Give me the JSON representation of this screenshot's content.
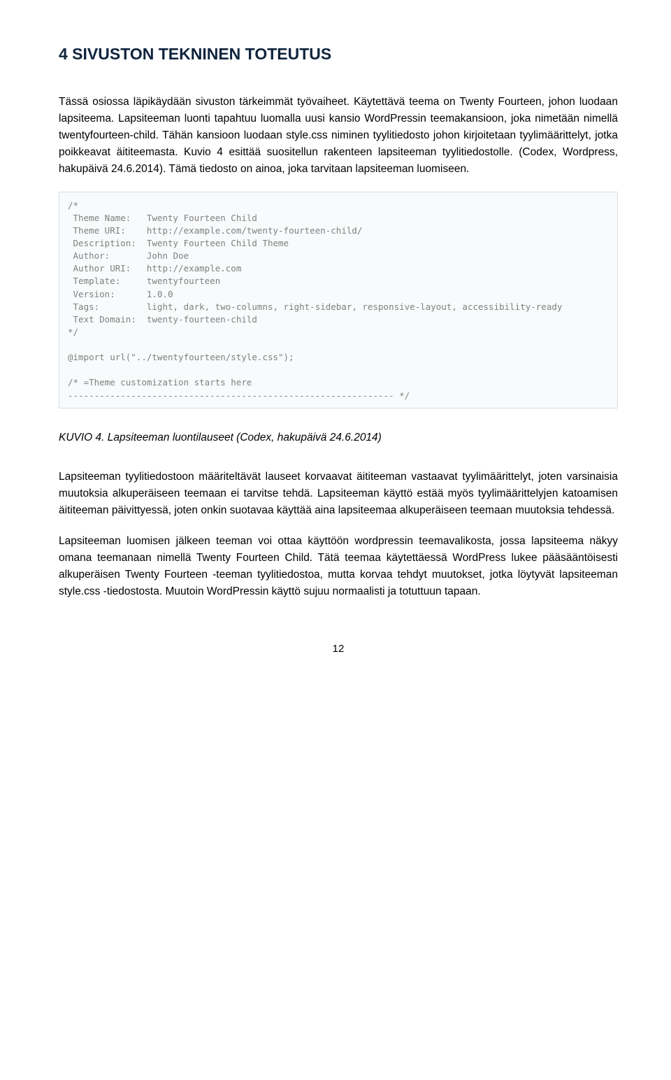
{
  "heading": "4   SIVUSTON TEKNINEN TOTEUTUS",
  "para1": "Tässä osiossa läpikäydään sivuston tärkeimmät työvaiheet. Käytettävä teema on Twenty Fourteen, johon luodaan lapsiteema. Lapsiteeman luonti tapahtuu luomalla uusi kansio WordPressin teemakansioon, joka nimetään nimellä twentyfourteen-child. Tähän kansioon luodaan style.css niminen tyylitiedosto johon kirjoitetaan tyylimäärittelyt, jotka poikkeavat äititeemasta. Kuvio 4 esittää suositellun rakenteen lapsiteeman tyylitiedostolle. (Codex, Wordpress, hakupäivä 24.6.2014). Tämä tiedosto on ainoa, joka tarvitaan lapsiteeman luomiseen.",
  "code": {
    "l01": "/*",
    "l02": " Theme Name:   Twenty Fourteen Child",
    "l03": " Theme URI:    http://example.com/twenty-fourteen-child/",
    "l04": " Description:  Twenty Fourteen Child Theme",
    "l05": " Author:       John Doe",
    "l06": " Author URI:   http://example.com",
    "l07": " Template:     twentyfourteen",
    "l08": " Version:      1.0.0",
    "l09": " Tags:         light, dark, two-columns, right-sidebar, responsive-layout, accessibility-ready",
    "l10": " Text Domain:  twenty-fourteen-child",
    "l11": "*/",
    "l12": "",
    "l13": "@import url(\"../twentyfourteen/style.css\");",
    "l14": "",
    "l15": "/* =Theme customization starts here",
    "l16": "-------------------------------------------------------------- */"
  },
  "caption": "KUVIO 4. Lapsiteeman luontilauseet (Codex, hakupäivä 24.6.2014)",
  "para2": "Lapsiteeman tyylitiedostoon määriteltävät lauseet korvaavat äititeeman vastaavat tyylimäärittelyt, joten varsinaisia muutoksia alkuperäiseen teemaan ei tarvitse tehdä. Lapsiteeman käyttö estää myös tyylimäärittelyjen katoamisen äititeeman päivittyessä, joten onkin suotavaa käyttää aina lapsiteemaa alkuperäiseen teemaan muutoksia tehdessä.",
  "para3": "Lapsiteeman luomisen jälkeen teeman voi ottaa käyttöön wordpressin teemavalikosta, jossa lapsiteema näkyy omana teemanaan nimellä Twenty Fourteen Child. Tätä teemaa käytettäessä WordPress lukee pääsääntöisesti alkuperäisen Twenty Fourteen -teeman tyylitiedostoa, mutta korvaa tehdyt muutokset, jotka löytyvät lapsiteeman style.css -tiedostosta. Muutoin WordPressin käyttö sujuu normaalisti ja totuttuun tapaan.",
  "page_number": "12"
}
